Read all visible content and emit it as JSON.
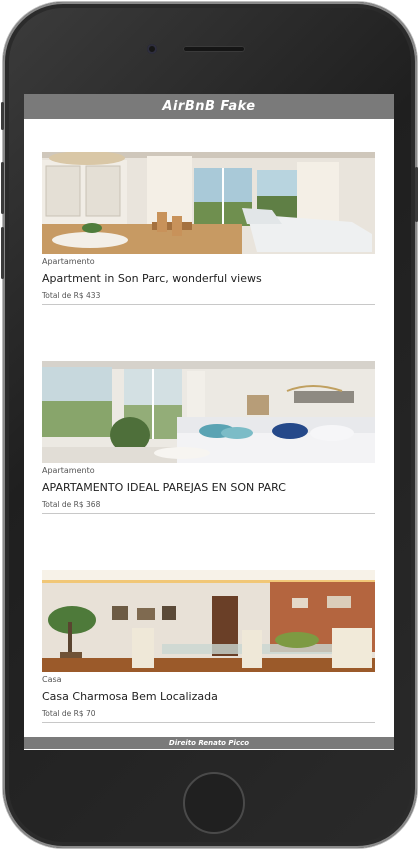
{
  "app": {
    "title": "AirBnB Fake"
  },
  "listings": [
    {
      "type": "Apartamento",
      "title": "Apartment in Son Parc, wonderful views",
      "price": "Total de R$ 433",
      "photo_icon": "living-room-photo"
    },
    {
      "type": "Apartamento",
      "title": "APARTAMENTO IDEAL PAREJAS EN SON PARC",
      "price": "Total de R$ 368",
      "photo_icon": "sofa-room-photo"
    },
    {
      "type": "Casa",
      "title": "Casa Charmosa Bem Localizada",
      "price": "Total de R$ 70",
      "photo_icon": "dining-room-photo"
    }
  ],
  "footer": {
    "text": "Direito Renato Picco"
  },
  "colors": {
    "bar": "#7a7a7a",
    "phone_body": "#2a2a2a"
  }
}
